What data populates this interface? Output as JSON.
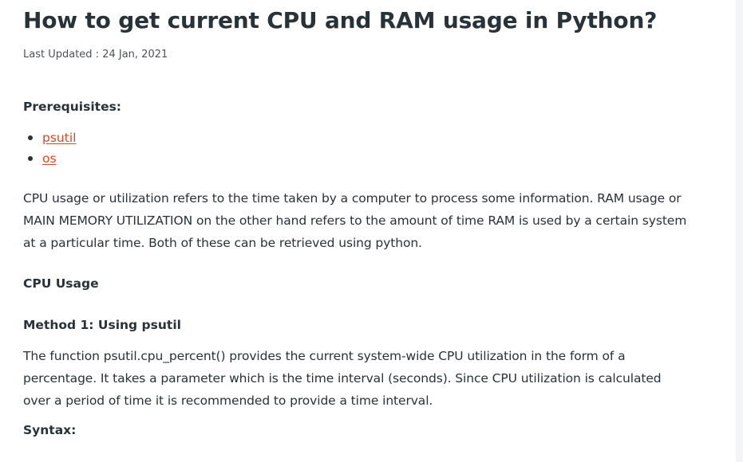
{
  "article": {
    "title": "How to get current CPU and RAM usage in Python?",
    "last_updated": "Last Updated : 24 Jan, 2021",
    "prerequisites_heading": "Prerequisites:",
    "prerequisites": [
      {
        "label": "psutil "
      },
      {
        "label": "os"
      }
    ],
    "intro_lines": [
      "CPU usage or utilization refers to the time taken by a computer to process some information. RAM usage or",
      "MAIN MEMORY UTILIZATION on the other hand refers to the amount of time RAM is used by a certain system",
      "at a particular time. Both of these can be retrieved using python."
    ],
    "cpu_usage_heading": "CPU Usage",
    "method1_heading": "Method 1: Using psutil",
    "method1_lines": [
      "The function psutil.cpu_percent() provides the current system-wide CPU utilization in the form of a",
      "percentage. It takes a parameter which is the time interval (seconds). Since CPU utilization is calculated",
      "over a period of time it is recommended to provide a time interval."
    ],
    "syntax_heading": "Syntax:"
  },
  "colors": {
    "text": "#273239",
    "link": "#e4441e",
    "meta": "#4c5256",
    "background": "#ffffff"
  }
}
